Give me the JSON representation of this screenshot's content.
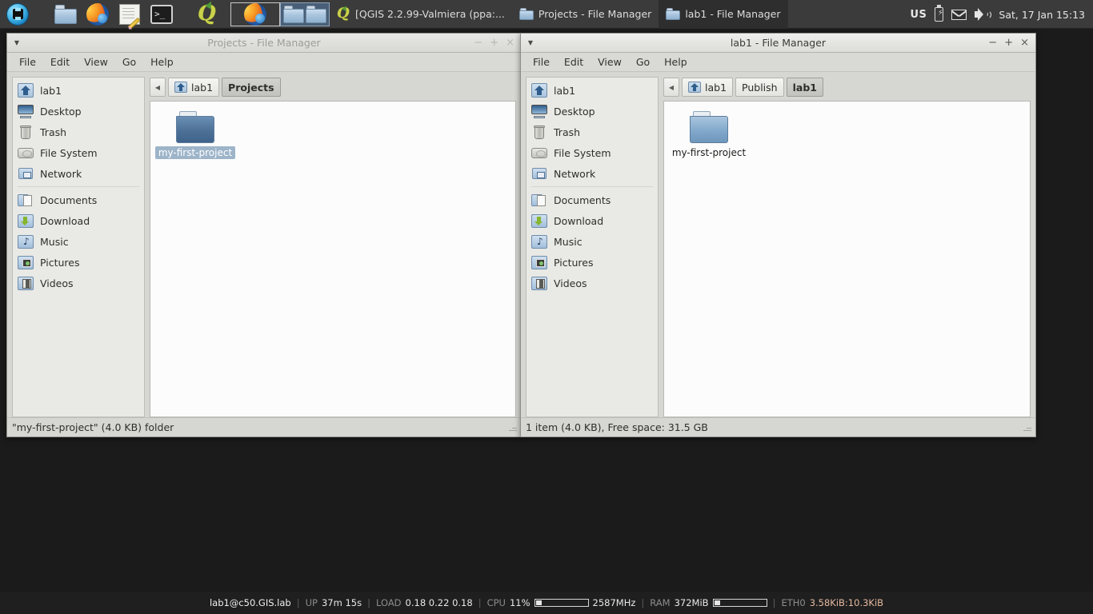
{
  "top_panel": {
    "launchers": [
      {
        "name": "whisker-menu",
        "icon": "globe-icon"
      },
      {
        "name": "file-manager",
        "icon": "folder-icon"
      },
      {
        "name": "web-browser",
        "icon": "firefox-icon"
      },
      {
        "name": "text-editor",
        "icon": "text-editor-icon"
      },
      {
        "name": "terminal",
        "icon": "terminal-icon"
      },
      {
        "name": "qgis",
        "icon": "qgis-icon"
      }
    ],
    "terminal_prompt": ">_",
    "qgis_glyph": "Q",
    "window_buttons": [
      {
        "label": "[QGIS 2.2.99-Valmiera (ppa:...",
        "icon": "qgis-icon",
        "active": false
      },
      {
        "label": "Projects - File Manager",
        "icon": "folder-icon",
        "active": false
      },
      {
        "label": "lab1 - File Manager",
        "icon": "folder-icon",
        "active": true
      }
    ],
    "tray": {
      "keyboard_layout": "US",
      "battery_icon": "battery-icon",
      "mail_icon": "mail-icon",
      "volume_icon": "speaker-icon",
      "clock": "Sat, 17 Jan  15:13"
    }
  },
  "menu_labels": [
    "File",
    "Edit",
    "View",
    "Go",
    "Help"
  ],
  "sidebar_items": [
    {
      "label": "lab1",
      "icon": "home-icon"
    },
    {
      "label": "Desktop",
      "icon": "desktop-icon"
    },
    {
      "label": "Trash",
      "icon": "trash-icon"
    },
    {
      "label": "File System",
      "icon": "harddisk-icon"
    },
    {
      "label": "Network",
      "icon": "network-icon"
    },
    {
      "label": "Documents",
      "icon": "documents-folder-icon"
    },
    {
      "label": "Download",
      "icon": "download-folder-icon"
    },
    {
      "label": "Music",
      "icon": "music-folder-icon"
    },
    {
      "label": "Pictures",
      "icon": "pictures-folder-icon"
    },
    {
      "label": "Videos",
      "icon": "videos-folder-icon"
    }
  ],
  "window_left": {
    "title": "Projects - File Manager",
    "titlebar_menu_icon": "chevron-down-icon",
    "minimize": "−",
    "maximize": "+",
    "close": "×",
    "back_icon": "◀",
    "breadcrumbs": [
      {
        "label": "lab1",
        "icon": "home-icon",
        "current": false
      },
      {
        "label": "Projects",
        "icon": "",
        "current": true
      }
    ],
    "files": [
      {
        "label": "my-first-project",
        "type": "folder",
        "selected": true
      }
    ],
    "status": "\"my-first-project\" (4.0 KB) folder"
  },
  "window_right": {
    "title": "lab1 - File Manager",
    "titlebar_menu_icon": "chevron-down-icon",
    "minimize": "−",
    "maximize": "+",
    "close": "×",
    "back_icon": "◀",
    "breadcrumbs": [
      {
        "label": "lab1",
        "icon": "home-icon",
        "current": false
      },
      {
        "label": "Publish",
        "icon": "",
        "current": false
      },
      {
        "label": "lab1",
        "icon": "",
        "current": true
      }
    ],
    "files": [
      {
        "label": "my-first-project",
        "type": "folder",
        "selected": false
      }
    ],
    "status": "1 item (4.0 KB), Free space: 31.5 GB"
  },
  "bottom_panel": {
    "host": "lab1@c50.GIS.lab",
    "up_label": "UP",
    "up_value": "37m 15s",
    "load_label": "LOAD",
    "load_value": "0.18 0.22 0.18",
    "cpu_label": "CPU",
    "cpu_value": "11%",
    "cpu_percent": 11,
    "cpu_freq": "2587MHz",
    "ram_label": "RAM",
    "ram_value": "372MiB",
    "ram_percent": 12,
    "eth_label": "ETH0",
    "eth_value": "3.58KiB:10.3KiB",
    "separator": "|"
  },
  "colors": {
    "panel_bg": "#3b3b3b",
    "desktop_bg": "#1b1b1b",
    "bottom_bg": "#1f1f1f",
    "window_bg": "#d6d6d2",
    "selection": "#9db4c9",
    "accent_eth": "#e6b9a0"
  }
}
